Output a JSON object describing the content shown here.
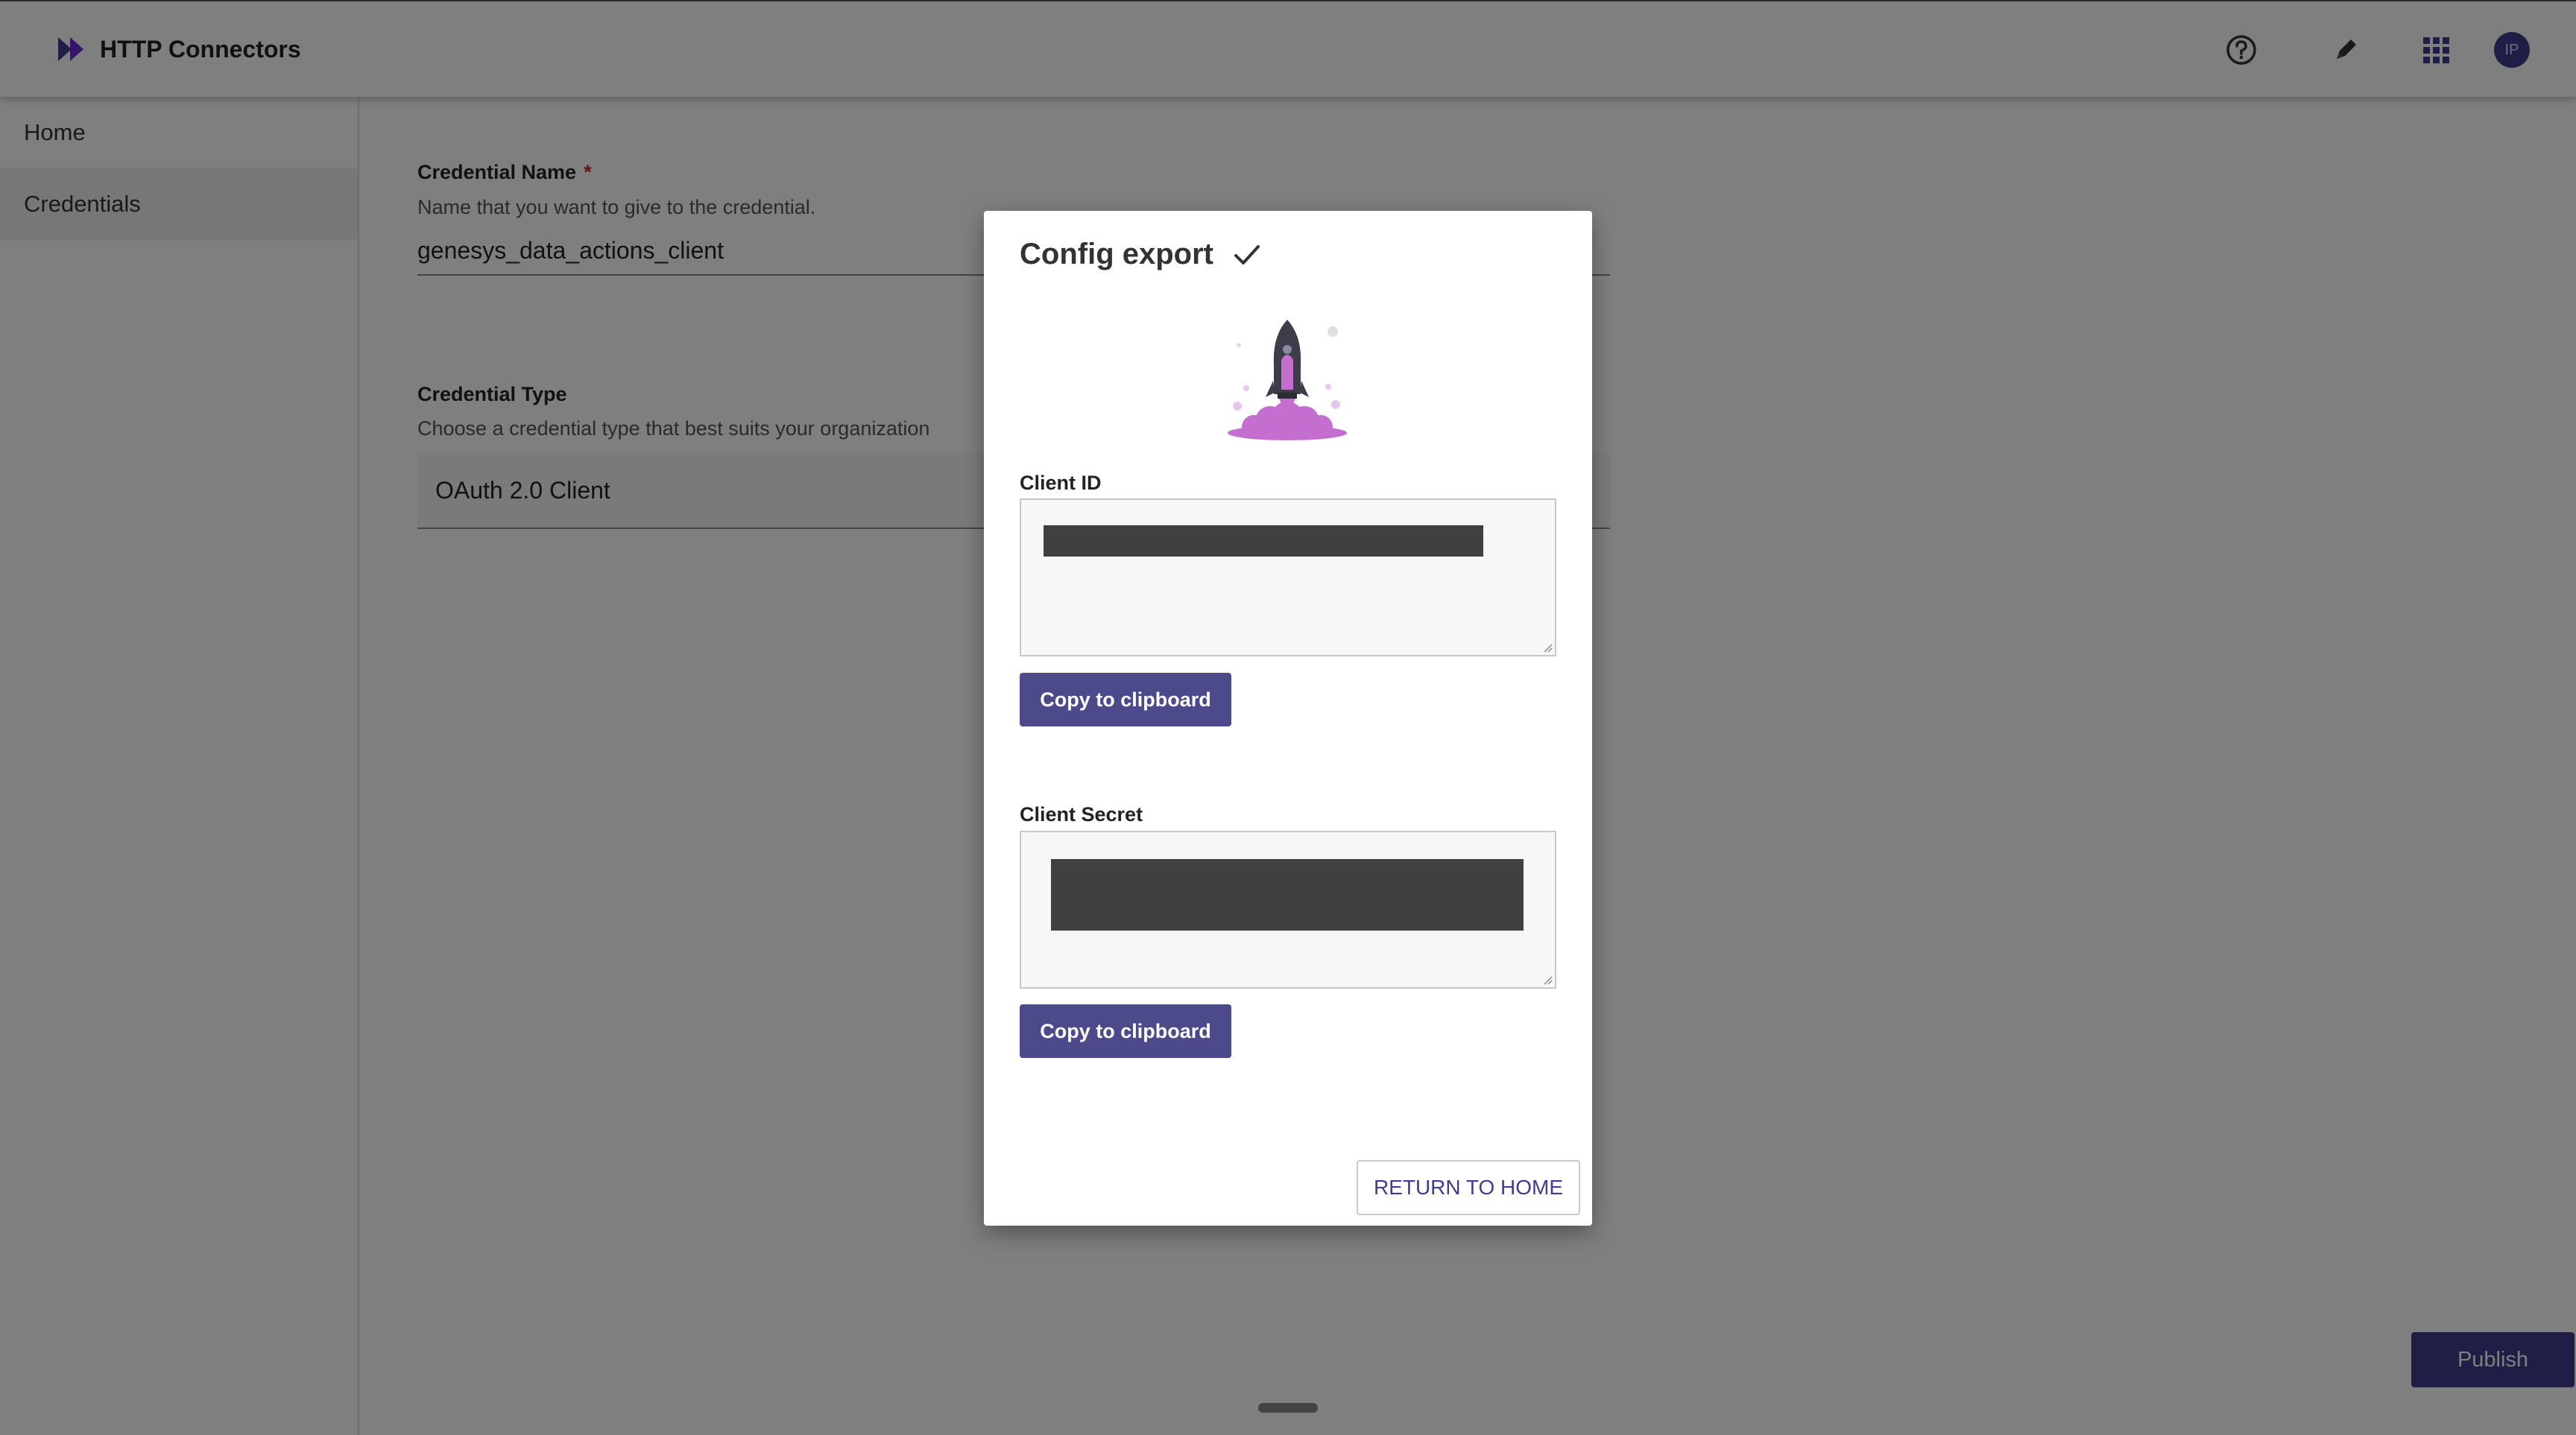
{
  "header": {
    "title": "HTTP Connectors",
    "icons": [
      "help-icon",
      "pencil-icon",
      "apps-grid-icon"
    ],
    "avatar_initials": "IP"
  },
  "sidebar": {
    "items": [
      {
        "label": "Home",
        "active": false
      },
      {
        "label": "Credentials",
        "active": true
      }
    ]
  },
  "form": {
    "credential_name": {
      "label": "Credential Name",
      "required_mark": "*",
      "hint": "Name that you want to give to the credential.",
      "value": "genesys_data_actions_client"
    },
    "credential_type": {
      "label": "Credential Type",
      "hint": "Choose a credential type that best suits your organization",
      "value": "OAuth 2.0 Client"
    },
    "publish_label": "Publish"
  },
  "modal": {
    "title": "Config export",
    "client_id_label": "Client ID",
    "client_secret_label": "Client Secret",
    "copy_label": "Copy to clipboard",
    "return_label": "RETURN TO HOME"
  },
  "colors": {
    "accent": "#3f3d8f",
    "copy_button": "#4d4a8c",
    "rocket": "#c46fd0",
    "redaction": "#404040"
  }
}
